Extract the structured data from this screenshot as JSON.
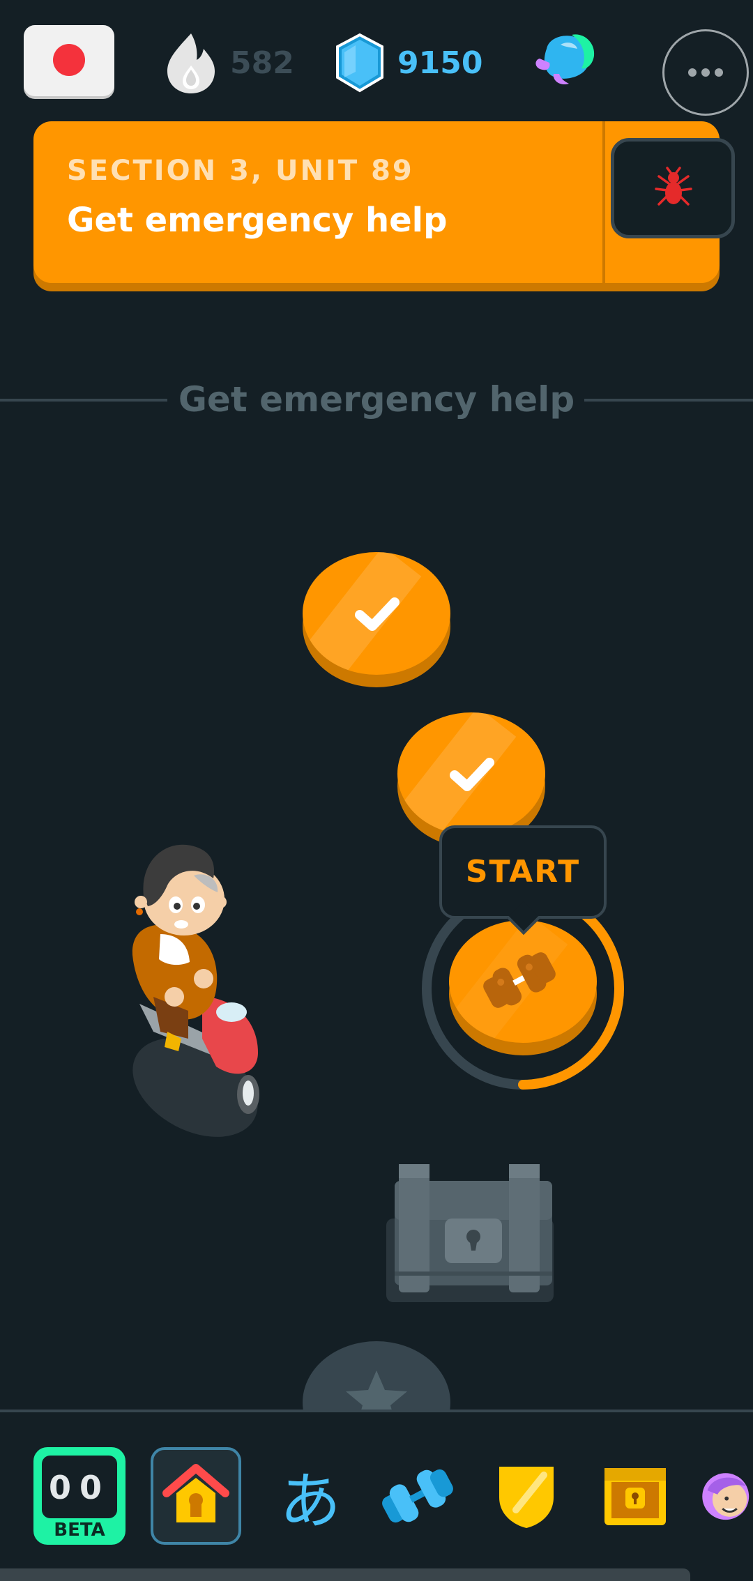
{
  "topbar": {
    "course_flag": "japanese-flag",
    "streak": "582",
    "gems": "9150",
    "hearts_icon": "super-heart-icon",
    "more_icon": "more-icon"
  },
  "unit": {
    "section_label": "SECTION 3, UNIT 89",
    "title": "Get emergency help",
    "guide_icon": "bug-icon"
  },
  "path": {
    "header": "Get emergency help",
    "start_label": "START",
    "lessons": [
      {
        "state": "completed",
        "icon": "checkmark-icon"
      },
      {
        "state": "completed",
        "icon": "checkmark-icon"
      },
      {
        "state": "current",
        "icon": "dumbbell-icon",
        "progress": 0.5
      },
      {
        "state": "locked",
        "icon": "treasure-chest-icon"
      },
      {
        "state": "locked",
        "icon": "star-icon"
      }
    ]
  },
  "nav": {
    "beta_screen": "00",
    "beta_label": "BETA",
    "kana": "あ",
    "items": [
      "video-call",
      "learn",
      "characters",
      "practice",
      "leagues",
      "quests",
      "profile"
    ]
  },
  "colors": {
    "background": "#141F25",
    "orange": "#FF9600",
    "orange_dark": "#CD7900",
    "blue": "#49C0F8",
    "border": "#37464F",
    "green": "#1EF2A4"
  }
}
